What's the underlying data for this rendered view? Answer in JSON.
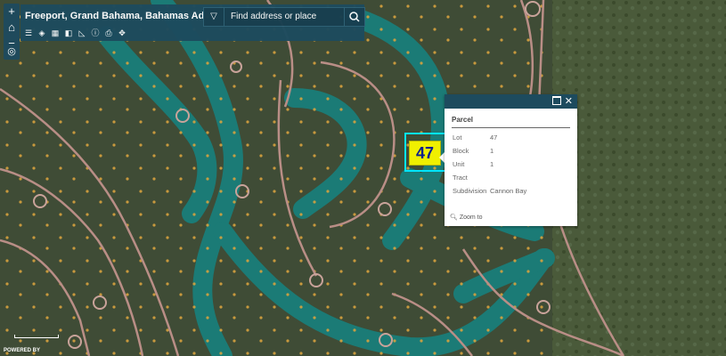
{
  "app": {
    "title": "Freeport, Grand Bahama, Bahamas Addresses"
  },
  "search": {
    "placeholder": "Find address or place"
  },
  "map_controls": {
    "zoom_in": "+",
    "home": "⌂",
    "zoom_out": "−",
    "locate": "◎"
  },
  "toolbar": {
    "icons": [
      "list-icon",
      "layers-icon",
      "grid-icon",
      "basemap-icon",
      "measure-icon",
      "info-icon",
      "print-icon",
      "move-icon"
    ]
  },
  "parcel_label": "47",
  "popup": {
    "title": "Parcel",
    "fields": [
      {
        "label": "Lot",
        "value": "47"
      },
      {
        "label": "Block",
        "value": "1"
      },
      {
        "label": "Unit",
        "value": "1"
      },
      {
        "label": "Tract",
        "value": ""
      },
      {
        "label": "Subdivision",
        "value": "Cannon Bay"
      }
    ],
    "zoom_to": "Zoom to"
  },
  "attribution": "POWERED BY",
  "colors": {
    "header": "#1d4b5e",
    "canal": "#1a7a78",
    "land": "#43513a",
    "road": "#b98e86",
    "parcel_highlight": "#f0f000"
  }
}
